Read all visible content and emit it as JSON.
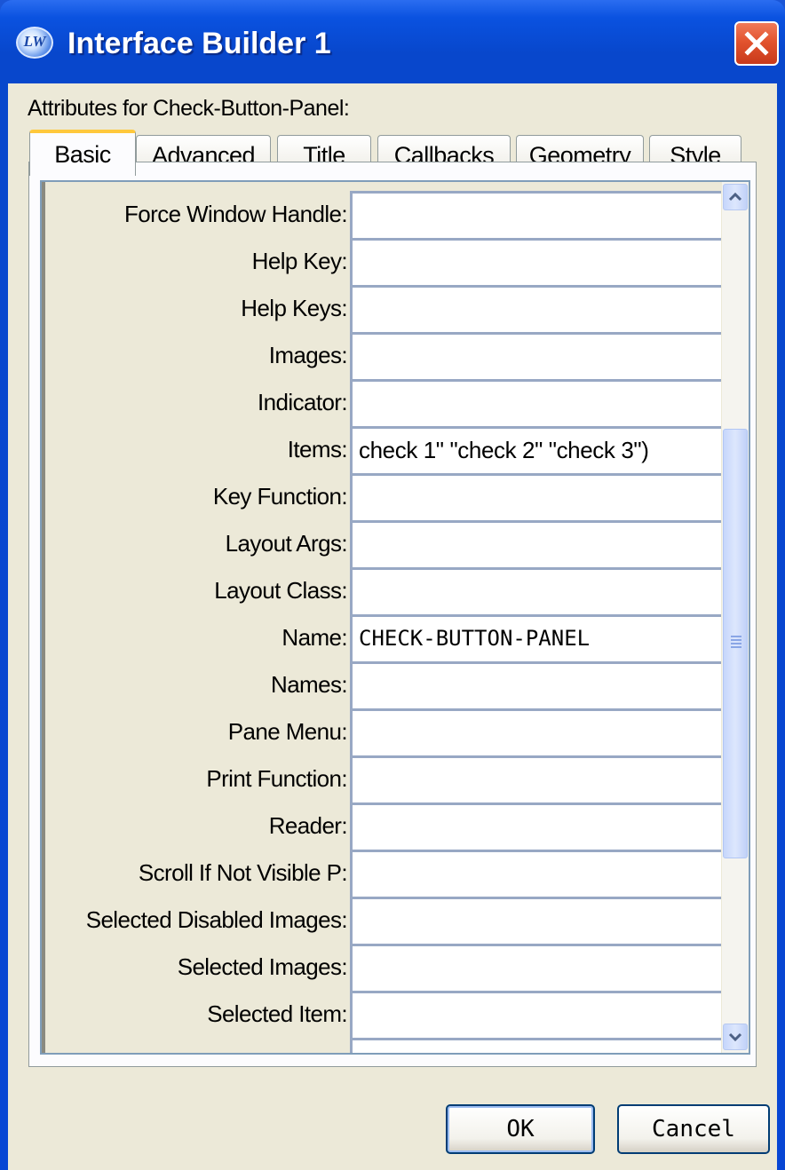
{
  "window": {
    "title": "Interface Builder 1",
    "icon": "LW"
  },
  "panel": {
    "label": "Attributes for Check-Button-Panel:"
  },
  "tabs": [
    {
      "label": "Basic",
      "active": true
    },
    {
      "label": "Advanced",
      "active": false
    },
    {
      "label": "Title",
      "active": false
    },
    {
      "label": "Callbacks",
      "active": false
    },
    {
      "label": "Geometry",
      "active": false
    },
    {
      "label": "Style",
      "active": false
    }
  ],
  "attributes": [
    {
      "label": "Force Window Handle:",
      "value": ""
    },
    {
      "label": "Help Key:",
      "value": ""
    },
    {
      "label": "Help Keys:",
      "value": ""
    },
    {
      "label": "Images:",
      "value": ""
    },
    {
      "label": "Indicator:",
      "value": ""
    },
    {
      "label": "Items:",
      "value": "check 1\" \"check 2\" \"check 3\")"
    },
    {
      "label": "Key Function:",
      "value": ""
    },
    {
      "label": "Layout Args:",
      "value": ""
    },
    {
      "label": "Layout Class:",
      "value": ""
    },
    {
      "label": "Name:",
      "value": "CHECK-BUTTON-PANEL"
    },
    {
      "label": "Names:",
      "value": ""
    },
    {
      "label": "Pane Menu:",
      "value": ""
    },
    {
      "label": "Print Function:",
      "value": ""
    },
    {
      "label": "Reader:",
      "value": ""
    },
    {
      "label": "Scroll If Not Visible P:",
      "value": ""
    },
    {
      "label": "Selected Disabled Images:",
      "value": ""
    },
    {
      "label": "Selected Images:",
      "value": ""
    },
    {
      "label": "Selected Item:",
      "value": ""
    }
  ],
  "buttons": {
    "ok": "OK",
    "cancel": "Cancel"
  },
  "colors": {
    "titlebar": "#0a52e0",
    "client": "#ece9d8",
    "active_tab_accent": "#ffc83c",
    "close_button": "#e2532e"
  }
}
